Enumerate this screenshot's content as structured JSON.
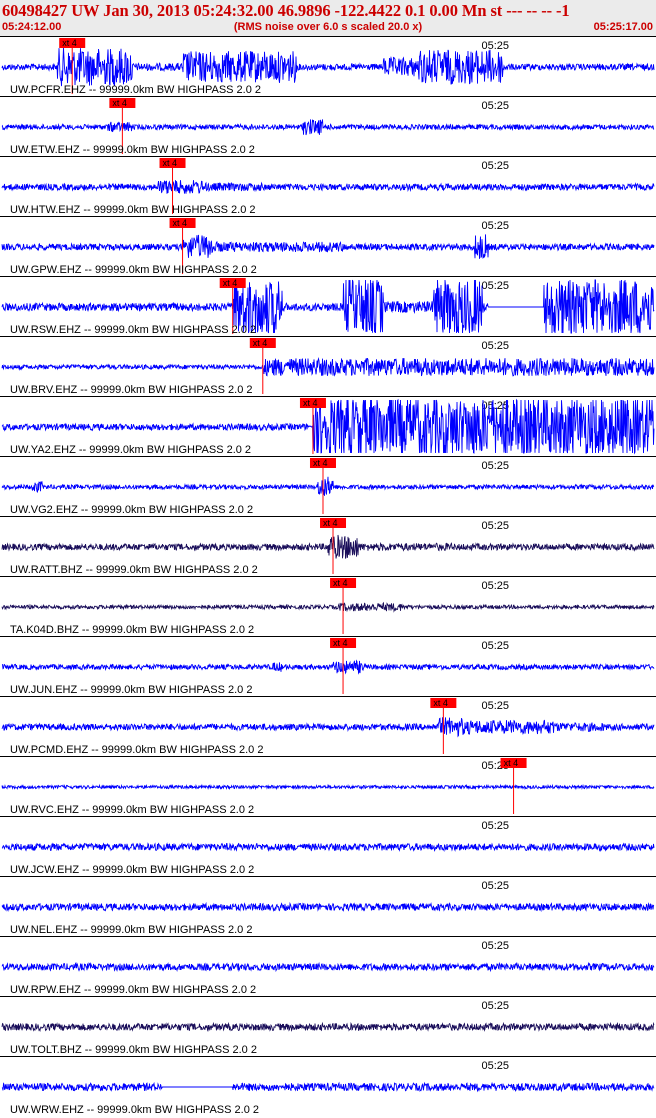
{
  "header": {
    "title": "60498427 UW Jan 30, 2013 05:24:32.00   46.9896 -122.4422  0.1 0.00 Mn st --- -- --  -1",
    "start_time": "05:24:12.00",
    "scale_note": "(RMS noise over 6.0 s scaled 20.0 x)",
    "end_time": "05:25:17.00"
  },
  "colors": {
    "title": "#cc0000",
    "header_bg": "#ebebeb",
    "trace_blue": "#0000ff",
    "trace_dark": "#1a0e5a",
    "pick_red": "#ff0000",
    "separator": "#000000"
  },
  "chart_data": {
    "type": "line",
    "x_unit": "time (UTC)",
    "x_start": "05:24:12.00",
    "x_end": "05:25:17.00",
    "minute_tick_label": "05:25",
    "minute_tick_seconds": 48,
    "time_window_seconds": 65,
    "pick_label": "xt 4",
    "traces": [
      {
        "label": "UW.PCFR.EHZ -- 99999.0km BW  HIGHPASS  2.0  2",
        "color": "blue",
        "pick_s": 7.0,
        "activity": [
          [
            5.5,
            13,
            6.0
          ],
          [
            13,
            18,
            1.2
          ],
          [
            18,
            29.5,
            5.0
          ],
          [
            29.5,
            38,
            1.0
          ],
          [
            38,
            41.5,
            3.0
          ],
          [
            41.5,
            50,
            5.5
          ],
          [
            50,
            65,
            0.9
          ]
        ],
        "base": 1.0
      },
      {
        "label": "UW.ETW.EHZ -- 99999.0km BW  HIGHPASS  2.0  2",
        "color": "blue",
        "pick_s": 12.0,
        "activity": [
          [
            10.5,
            13,
            1.6
          ],
          [
            30,
            32,
            2.5
          ]
        ],
        "base": 0.8
      },
      {
        "label": "UW.HTW.EHZ -- 99999.0km BW  HIGHPASS  2.0  2",
        "color": "blue",
        "pick_s": 17.0,
        "activity": [
          [
            15.5,
            20,
            2.2
          ],
          [
            20,
            26,
            1.3
          ]
        ],
        "base": 1.0
      },
      {
        "label": "UW.GPW.EHZ -- 99999.0km BW  HIGHPASS  2.0  2",
        "color": "blue",
        "pick_s": 18.0,
        "activity": [
          [
            18,
            21,
            3.8
          ],
          [
            21,
            28,
            1.6
          ],
          [
            28,
            34,
            1.6
          ],
          [
            47,
            48.5,
            4.0
          ]
        ],
        "base": 1.0
      },
      {
        "label": "UW.RSW.EHZ -- 99999.0km BW  HIGHPASS  2.0  2",
        "color": "blue",
        "pick_s": 23.0,
        "activity": [
          [
            23,
            28,
            9.0
          ],
          [
            34,
            38,
            9.0
          ],
          [
            38,
            43,
            1.8
          ],
          [
            43,
            47,
            9.0
          ],
          [
            47,
            48,
            9.0
          ],
          [
            48.5,
            54,
            0
          ],
          [
            54,
            65,
            9.0
          ]
        ],
        "base": 1.2
      },
      {
        "label": "UW.BRV.EHZ -- 99999.0km BW  HIGHPASS  2.0  2",
        "color": "blue",
        "pick_s": 26.0,
        "activity": [
          [
            26,
            65,
            2.8
          ]
        ],
        "base": 0.7
      },
      {
        "label": "UW.YA2.EHZ -- 99999.0km BW  HIGHPASS  2.0  2",
        "color": "blue",
        "pick_s": 31.0,
        "activity": [
          [
            31,
            65,
            9.5
          ]
        ],
        "base": 1.0
      },
      {
        "label": "UW.VG2.EHZ -- 99999.0km BW  HIGHPASS  2.0  2",
        "color": "blue",
        "pick_s": 32.0,
        "activity": [
          [
            3,
            4,
            1.8
          ],
          [
            31.5,
            33,
            3.2
          ]
        ],
        "base": 0.7
      },
      {
        "label": "UW.RATT.BHZ -- 99999.0km BW  HIGHPASS  2.0  2",
        "color": "dark",
        "pick_s": 33.0,
        "activity": [
          [
            32.5,
            35.5,
            3.8
          ],
          [
            35.5,
            45,
            1.2
          ]
        ],
        "base": 1.0
      },
      {
        "label": "TA.K04D.BHZ -- 99999.0km BW  HIGHPASS  2.0  2",
        "color": "dark",
        "pick_s": 34.0,
        "activity": [
          [
            33.5,
            40,
            1.3
          ]
        ],
        "base": 0.6
      },
      {
        "label": "UW.JUN.EHZ -- 99999.0km BW  HIGHPASS  2.0  2",
        "color": "blue",
        "pick_s": 34.0,
        "activity": [
          [
            33,
            36,
            2.0
          ],
          [
            27,
            28,
            1.5
          ]
        ],
        "base": 0.8
      },
      {
        "label": "UW.PCMD.EHZ -- 99999.0km BW  HIGHPASS  2.0  2",
        "color": "blue",
        "pick_s": 44.0,
        "activity": [
          [
            43.5,
            46,
            3.0
          ],
          [
            46,
            55,
            2.2
          ],
          [
            55,
            60,
            1.4
          ]
        ],
        "base": 1.0
      },
      {
        "label": "UW.RVC.EHZ -- 99999.0km BW  HIGHPASS  2.0  2",
        "color": "blue",
        "pick_s": 51.0,
        "activity": [],
        "base": 0.5
      },
      {
        "label": "UW.JCW.EHZ -- 99999.0km BW  HIGHPASS  2.0  2",
        "color": "blue",
        "pick_s": null,
        "activity": [],
        "base": 1.1
      },
      {
        "label": "UW.NEL.EHZ -- 99999.0km BW  HIGHPASS  2.0  2",
        "color": "blue",
        "pick_s": null,
        "activity": [],
        "base": 1.1
      },
      {
        "label": "UW.RPW.EHZ -- 99999.0km BW  HIGHPASS  2.0  2",
        "color": "blue",
        "pick_s": null,
        "activity": [],
        "base": 1.1
      },
      {
        "label": "UW.TOLT.BHZ -- 99999.0km BW  HIGHPASS  2.0  2",
        "color": "dark",
        "pick_s": null,
        "activity": [],
        "base": 1.1
      },
      {
        "label": "UW.WRW.EHZ -- 99999.0km BW  HIGHPASS  2.0  2",
        "color": "blue",
        "pick_s": null,
        "activity": [
          [
            16,
            23,
            0
          ]
        ],
        "base": 1.2
      }
    ]
  }
}
